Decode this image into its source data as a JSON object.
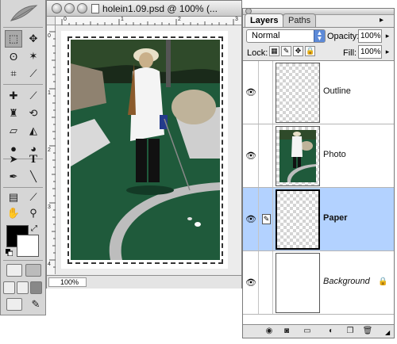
{
  "colors": {
    "active_layer": "#b3d2ff",
    "foreground": "#000000",
    "background": "#ffffff",
    "grass": "#1f5a3b"
  },
  "document": {
    "title": "holein1.09.psd @ 100% (...",
    "zoom": "100%",
    "ruler_top": [
      "0",
      "1",
      "2",
      "3"
    ],
    "ruler_left": [
      "0",
      "1",
      "2",
      "3",
      "4"
    ]
  },
  "tools": {
    "names": [
      "marquee-tool-icon",
      "move-tool-icon",
      "lasso-tool-icon",
      "magic-wand-tool-icon",
      "crop-tool-icon",
      "slice-tool-icon",
      "healing-brush-tool-icon",
      "brush-tool-icon",
      "clone-stamp-tool-icon",
      "history-brush-tool-icon",
      "eraser-tool-icon",
      "paint-bucket-tool-icon",
      "blur-tool-icon",
      "dodge-tool-icon",
      "path-selection-tool-icon",
      "type-tool-icon",
      "pen-tool-icon",
      "line-tool-icon",
      "notes-tool-icon",
      "eyedropper-tool-icon",
      "hand-tool-icon",
      "zoom-tool-icon"
    ]
  },
  "layers_panel": {
    "tabs": [
      "Layers",
      "Paths"
    ],
    "blend_mode": "Normal",
    "opacity_label": "Opacity:",
    "opacity_value": "100%",
    "lock_label": "Lock:",
    "fill_label": "Fill:",
    "fill_value": "100%",
    "layers": [
      {
        "name": "Outline",
        "visible": true,
        "active": false,
        "thumb": "transparent"
      },
      {
        "name": "Photo",
        "visible": true,
        "active": false,
        "thumb": "photo"
      },
      {
        "name": "Paper",
        "visible": true,
        "active": true,
        "thumb": "transparent"
      },
      {
        "name": "Background",
        "visible": true,
        "active": false,
        "thumb": "white",
        "locked": true
      }
    ]
  }
}
